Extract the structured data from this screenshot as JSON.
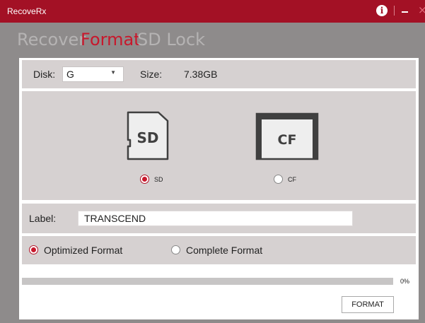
{
  "window": {
    "title": "RecoveRx",
    "info_icon": "info-icon",
    "minimize_icon": "minimize-icon",
    "close_icon": "close-icon",
    "close_glyph": "×",
    "info_glyph": "i"
  },
  "tabs": [
    {
      "label": "Recover",
      "active": false
    },
    {
      "label": "Format",
      "active": true
    },
    {
      "label": "SD Lock",
      "active": false
    }
  ],
  "disk": {
    "label": "Disk:",
    "selected": "G",
    "size_label": "Size:",
    "size_value": "7.38GB"
  },
  "card_type": {
    "options": [
      {
        "card_text": "SD",
        "radio_label": "SD",
        "checked": true,
        "icon": "sd-card-icon"
      },
      {
        "card_text": "CF",
        "radio_label": "CF",
        "checked": false,
        "icon": "cf-card-icon"
      }
    ]
  },
  "volume_label": {
    "label": "Label:",
    "value": "TRANSCEND"
  },
  "format_mode": {
    "options": [
      {
        "label": "Optimized Format",
        "checked": true
      },
      {
        "label": "Complete Format",
        "checked": false
      }
    ]
  },
  "progress": {
    "percent": 0,
    "text": "0%"
  },
  "actions": {
    "format_label": "FORMAT"
  },
  "colors": {
    "accent": "#c8182c",
    "titlebar": "#a31125",
    "background": "#8e8b8b",
    "panel": "#d6d1d1",
    "tab_inactive": "#b5b3b3"
  }
}
